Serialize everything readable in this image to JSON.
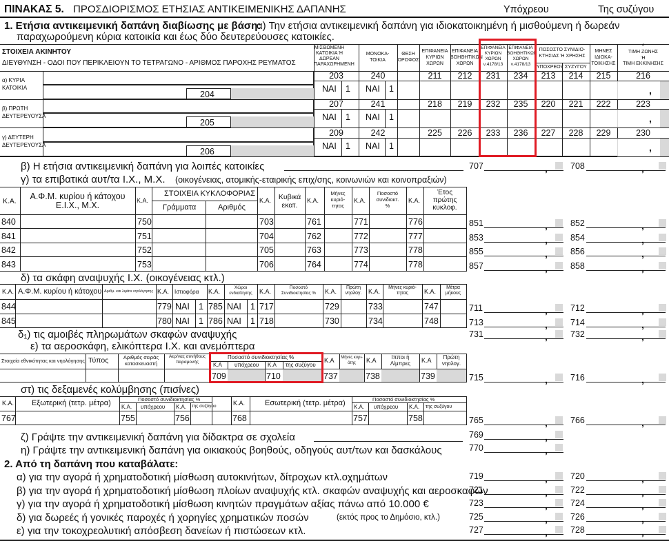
{
  "header": {
    "table_label": "ΠΙΝΑΚΑΣ 5.",
    "table_title": "ΠΡΟΣΔΙΟΡΙΣΜΟΣ ΕΤΗΣΙΑΣ ΑΝΤΙΚΕΙΜΕΝΙΚΗΣ ΔΑΠΑΝΗΣ",
    "taxpayer": "Υπόχρεου",
    "spouse": "Της συζύγου"
  },
  "section1": {
    "heading": "1. Ετήσια αντικειμενική δαπάνη διαβίωσης με βάση:",
    "intro": "α) Την ετήσια αντικειμενική δαπάνη για ιδιοκατοικημένη ή μισθούμενη ή δωρεάν",
    "intro2": "παραχωρούμενη κύρια κατοικία και έως δύο δευτερεύουσες κατοικίες.",
    "property_header": "ΣΤΟΙΧΕΙΑ ΑΚΙΝΗΤΟΥ",
    "address_header": "ΔΙΕΥΘΥΝΣΗ - ΟΔΟΙ ΠΟΥ ΠΕΡΙΚΛΕΙΟΥΝ ΤΟ ΤΕΤΡΑΓΩΝΟ - ΑΡΙΘΜΟΣ ΠΑΡΟΧΗΣ ΡΕΥΜΑΤΟΣ",
    "col_rented": [
      "ΜΙΣΘΩΜΕΝΗ",
      "ΚΑΤΟΙΚΙΑ Ή",
      "ΔΩΡΕΑΝ",
      "ΠΑΡΑΧΩΡΗΜΕΝΗ"
    ],
    "col_detached": [
      "ΜΟΝΟΚΑ-",
      "ΤΟΙΚΙΑ"
    ],
    "col_floor": [
      "ΘΕΣΗ",
      "ΟΡΟΦΟΣ"
    ],
    "col_main": [
      "ΕΠΙΦΑΝΕΙΑ",
      "ΚΥΡΙΩΝ",
      "ΧΩΡΩΝ"
    ],
    "col_aux": [
      "ΕΠΙΦΑΝΕΙΑ",
      "ΒΟΗΘΗΤΙΚΩΝ",
      "ΧΩΡΩΝ"
    ],
    "col_main_use": [
      "ΕΠΙΦΑΝΕΙΑ",
      "ΚΥΡΙΩΝ",
      "ΧΩΡΩΝ",
      "ν.4178/13"
    ],
    "col_aux_use": [
      "ΕΠΙΦΑΝΕΙΑ",
      "ΒΟΗΘΗΤΙΚΩΝ",
      "ΧΩΡΩΝ",
      "ν.4178/13"
    ],
    "col_share": [
      "ΠΟΣΟΣΤΟ ΣΥΝΙΔΙΟ-",
      "ΚΤΗΣΙΑΣ Ή ΧΡΗΣΗΣ"
    ],
    "col_share_sub": [
      "ΥΠΟΧΡΕΟΥ",
      "ΣΥΖΥΓΟΥ"
    ],
    "col_months": [
      "ΜΗΝΕΣ",
      "ΙΔΙΟΚΑ-",
      "ΤΟΙΚΗΣΗΣ"
    ],
    "col_zone": [
      "*",
      "ΤΙΜΗ ΖΩΝΗΣ",
      "Ή",
      "ΤΙΜΗ ΕΚΚΙΝΗΣΗΣ"
    ],
    "rows": [
      {
        "label1": "α) ΚΥΡΙΑ",
        "label2": "ΚΑΤΟΙΚΙΑ",
        "code_addr": "204",
        "codes": [
          "203",
          "240",
          "211",
          "212",
          "231",
          "234",
          "213",
          "214",
          "215",
          "216"
        ]
      },
      {
        "label1": "β) ΠΡΩΤΗ",
        "label2": "ΔΕΥΤΕΡΕΥΟΥΣΑ",
        "code_addr": "205",
        "codes": [
          "207",
          "241",
          "218",
          "219",
          "232",
          "235",
          "220",
          "221",
          "222",
          "223"
        ]
      },
      {
        "label1": "γ) ΔΕΥΤΕΡΗ",
        "label2": "ΔΕΥΤΕΡΕΥΟΥΣΑ",
        "code_addr": "206",
        "codes": [
          "209",
          "242",
          "225",
          "226",
          "233",
          "236",
          "227",
          "228",
          "229",
          "230"
        ]
      }
    ],
    "yes": "ΝΑΙ",
    "one": "1"
  },
  "lines": {
    "b_other": {
      "text": "β) Η ετήσια αντικειμενική δαπάνη για λοιπές κατοικίες",
      "code1": "707",
      "code2": "708"
    },
    "c_cars": {
      "text": "γ) τα επιβατικά αυτ/τα Ι.Χ., Μ.Χ.",
      "note": "(οικογένειας, ατομικής-εταιρικής επιχ/σης, κοινωνιών και κοινοπραξιών)"
    },
    "d_boats": {
      "text": "δ) τα σκάφη αναψυχής Ι.Χ. (οικογένειας κτλ.)"
    },
    "d1_crew": {
      "text": "δ₁) τις αμοιβές πληρωμάτων σκαφών αναψυχής",
      "code1": "731",
      "code2": "732"
    },
    "e_aircraft": {
      "text": "ε) τα αεροσκάφη, ελικόπτερα Ι.Χ. και ανεμόπτερα"
    },
    "st_pools": {
      "text": "στ) τις δεξαμενές κολύμβησης (πισίνες)"
    },
    "z_tuition": {
      "text": "ζ) Γράψτε την αντικειμενική δαπάνη για δίδακτρα σε σχολεία",
      "code": "769"
    },
    "h_helpers": {
      "text": "η) Γράψτε την αντικειμενική δαπάνη για οικιακούς βοηθούς, οδηγούς αυτ/των και δασκάλους",
      "code": "770"
    }
  },
  "cars": {
    "headers": {
      "ka": "Κ.Α.",
      "afm": "Α.Φ.Μ. κυρίου ή κάτοχου",
      "afm2": "Ε.Ι.Χ., Μ.Χ.",
      "reg": "ΣΤΟΙΧΕΙΑ ΚΥΚΛΟΦΟΡΙΑΣ",
      "letters": "Γράμματα",
      "number": "Αριθμός",
      "cc": "Κυβικά",
      "cc2": "εκατ.",
      "months": "Μήνες",
      "months2": "κυριό-",
      "months3": "τητας",
      "share": "Ποσοστό",
      "share2": "συνιδιοκτ.",
      "share3": "%",
      "year": "Έτος",
      "year2": "πρώτης",
      "year3": "κυκλοφ."
    },
    "rows": [
      {
        "c1": "840",
        "c2": "750",
        "c3": "703",
        "c4": "761",
        "c5": "771",
        "c6": "776",
        "r1": "851",
        "r2": "852"
      },
      {
        "c1": "841",
        "c2": "751",
        "c3": "704",
        "c4": "762",
        "c5": "772",
        "c6": "777",
        "r1": "853",
        "r2": "854"
      },
      {
        "c1": "842",
        "c2": "752",
        "c3": "705",
        "c4": "763",
        "c5": "773",
        "c6": "778",
        "r1": "855",
        "r2": "856"
      },
      {
        "c1": "843",
        "c2": "753",
        "c3": "706",
        "c4": "764",
        "c5": "774",
        "c6": "778",
        "r1": "857",
        "r2": "858"
      }
    ]
  },
  "boats": {
    "headers": {
      "ka": "Κ.Α.",
      "afm": "Α.Φ.Μ. κυρίου ή κάτοχου",
      "reg": "Αριθμ. και λιμάνι νηολόγησης",
      "hull": "Ιστιοφόρα",
      "rooms": "Χώροι",
      "rooms2": "ενδιαίτησης",
      "share": "Ποσοστό",
      "share2": "Συνιδιοκτησίας %",
      "first": "Πρώτη",
      "first2": "νηολογ.",
      "months": "Μήνες κυριό-",
      "months2": "τητας",
      "length": "Μέτρα",
      "length2": "μήκους"
    },
    "rows": [
      {
        "c1": "844",
        "c2": "779",
        "c3": "785",
        "c4": "717",
        "c5": "729",
        "c6": "733",
        "c7": "747",
        "r1": "711",
        "r2": "712"
      },
      {
        "c1": "845",
        "c2": "780",
        "c3": "786",
        "c4": "718",
        "c5": "730",
        "c6": "734",
        "c7": "748",
        "r1": "713",
        "r2": "714"
      }
    ]
  },
  "aircraft": {
    "headers": {
      "reg": "Στοιχεία εθνικότητας και νηολόγησης",
      "type": "Τύπος",
      "serial": "Αριθμός σειράς",
      "serial2": "κατασκευαστή",
      "lic": "Αερ/νας συνήθους",
      "lic2": "παραμονής",
      "share": "Ποσοστό συνιδιοκτησίας %",
      "ka": "Κ.Α",
      "taxpayer": "υπόχρεου",
      "spouse": "της συζύγου",
      "months": "Μήνες κυρι-",
      "months2": "ότης",
      "power": "Ιπποι ή",
      "power2": "Λίμπρες",
      "first": "Πρώτη",
      "first2": "νηολογ."
    },
    "codes": {
      "c1": "709",
      "c2": "710",
      "c3": "737",
      "c4": "738",
      "c5": "739",
      "r1": "715",
      "r2": "716"
    }
  },
  "pools": {
    "headers": {
      "ka": "Κ.Α.",
      "outdoor": "Εξωτερική (τετρ. μέτρα)",
      "indoor": "Εσωτερική (τετρ. μέτρα)",
      "share": "Ποσοστό συνιδιοκτησίας %",
      "taxpayer": "υπόχρεου",
      "spouse": "της συζύγου"
    },
    "codes": {
      "c1": "767",
      "c2": "755",
      "c3": "756",
      "c4": "768",
      "c5": "757",
      "c6": "758",
      "r1": "765",
      "r2": "766"
    }
  },
  "section2": {
    "heading": "2. Από τη δαπάνη που καταβάλατε:",
    "items": [
      {
        "text": "α) για την αγορά ή χρηματοδοτική μίσθωση αυτοκινήτων, δίτροχων κτλ.οχημάτων",
        "code1": "719",
        "code2": "720"
      },
      {
        "text": "β) για την αγορά ή χρηματοδοτική μίσθωση πλοίων αναψυχής κτλ. σκαφών αναψυχής και αεροσκαφών",
        "code1": "721",
        "code2": "722"
      },
      {
        "text": "γ) για την αγορά ή χρηματοδοτική μίσθωση κινητών πραγμάτων αξίας πάνω από 10.000 €",
        "code1": "723",
        "code2": "724"
      },
      {
        "text": "δ) για δωρεές ή γονικές παροχές ή χορηγίες χρηματικών ποσών",
        "note": "(εκτός προς το Δημόσιο, κτλ.)",
        "code1": "725",
        "code2": "726"
      },
      {
        "text": "ε) για την τοκοχρεολυτική απόσβεση δανείων ή πιστώσεων κτλ.",
        "code1": "727",
        "code2": "728"
      }
    ]
  },
  "colors": {
    "highlight": "#e01b24",
    "shade": "#d9d9d9"
  }
}
